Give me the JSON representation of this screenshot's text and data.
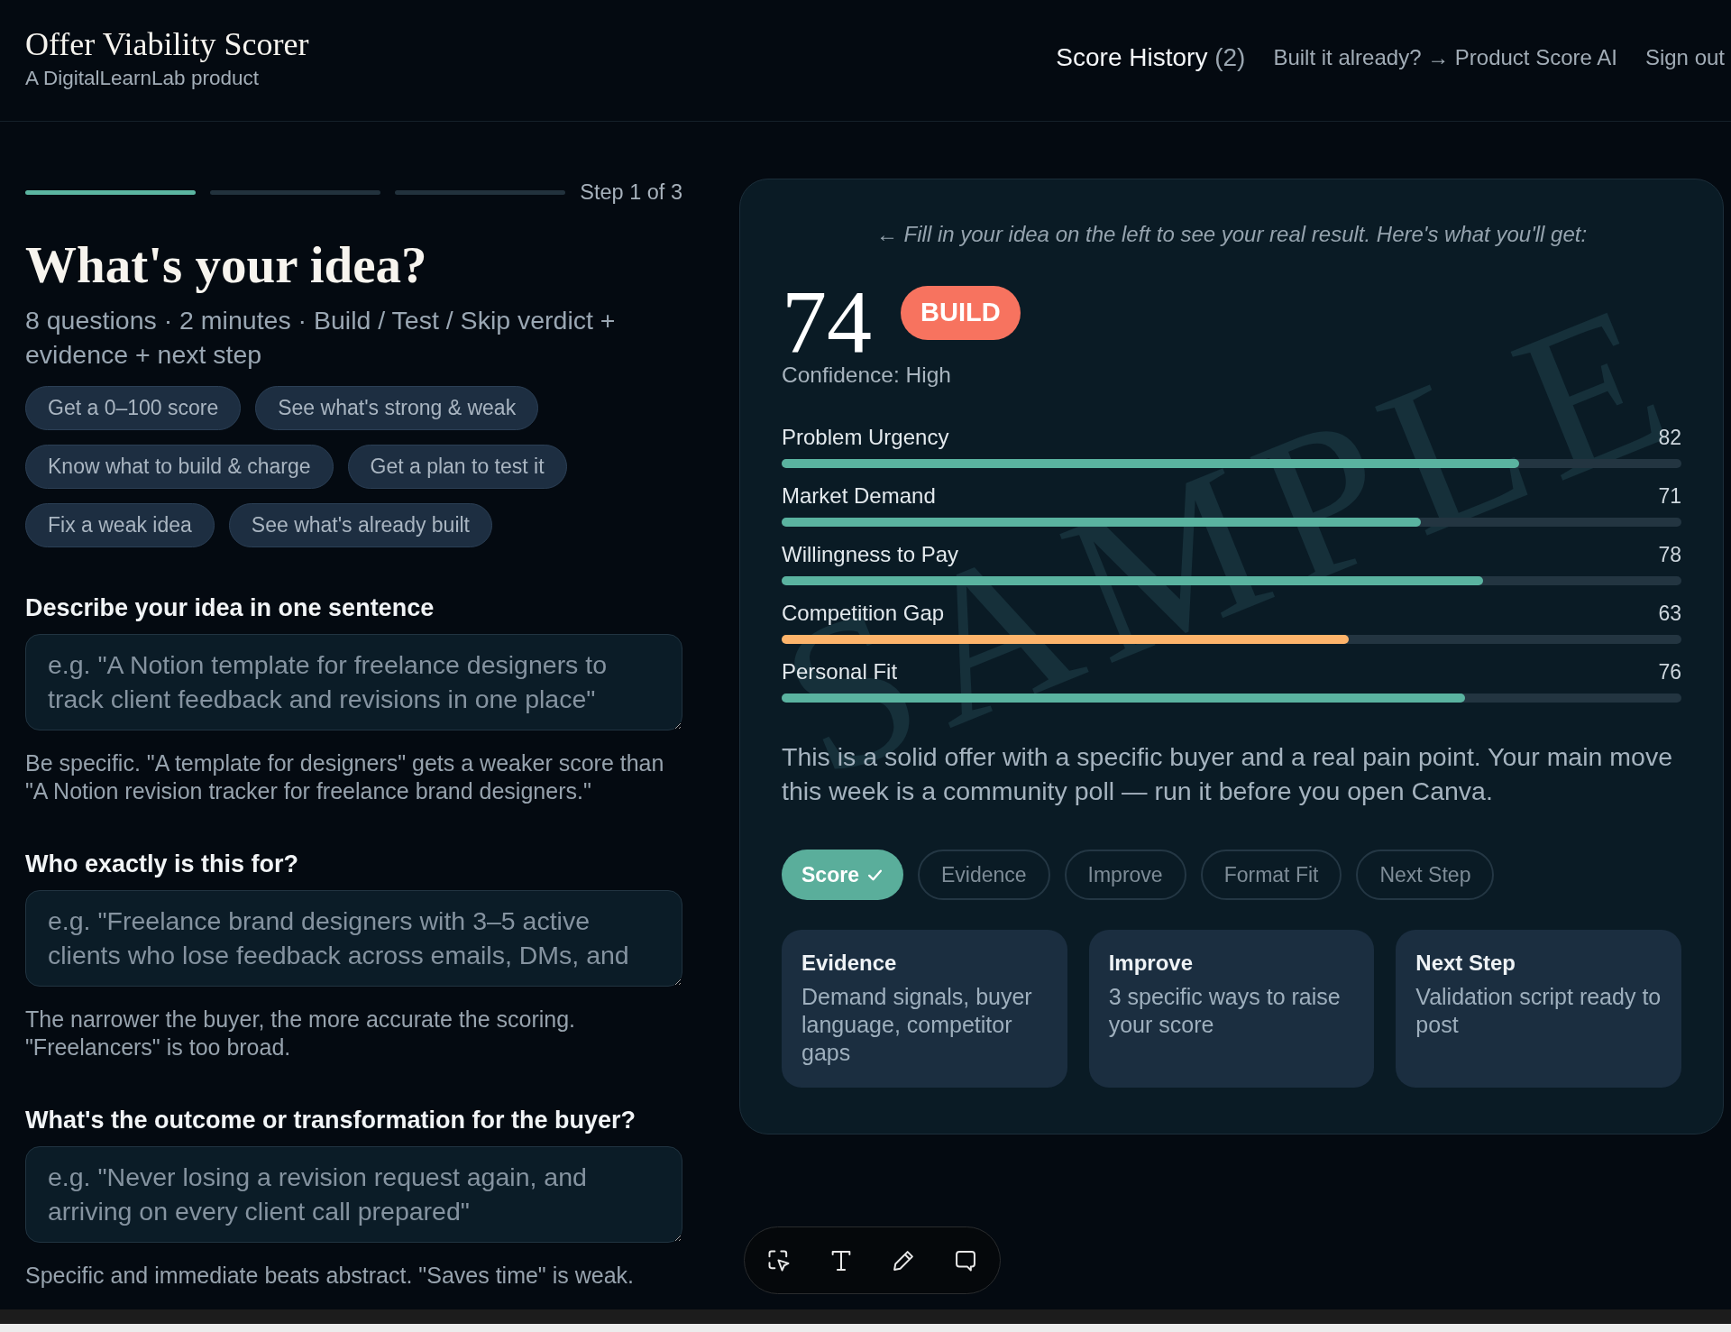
{
  "header": {
    "title": "Offer Viability Scorer",
    "subtitle": "A DigitalLearnLab product",
    "history_link": {
      "label": "Score History",
      "count": "(2)"
    },
    "links": [
      "Built it already? → Product Score AI",
      "Sign out"
    ]
  },
  "progress": {
    "segments": [
      {
        "active": true
      },
      {
        "active": false
      },
      {
        "active": false
      }
    ],
    "label": "Step 1 of 3"
  },
  "intro": {
    "heading": "What's your idea?",
    "description": "8 questions · 2 minutes · Build / Test / Skip verdict + evidence + next step",
    "chips": [
      "Get a 0–100 score",
      "See what's strong & weak",
      "Know what to build & charge",
      "Get a plan to test it",
      "Fix a weak idea",
      "See what's already built"
    ]
  },
  "fields": [
    {
      "label": "Describe your idea in one sentence",
      "placeholder": "e.g. \"A Notion template for freelance designers to track client feedback and revisions in one place\"",
      "hint": "Be specific. \"A template for designers\" gets a weaker score than \"A Notion revision tracker for freelance brand designers.\""
    },
    {
      "label": "Who exactly is this for?",
      "placeholder": "e.g. \"Freelance brand designers with 3–5 active clients who lose feedback across emails, DMs, and",
      "hint": "The narrower the buyer, the more accurate the scoring. \"Freelancers\" is too broad."
    },
    {
      "label": "What's the outcome or transformation for the buyer?",
      "placeholder": "e.g. \"Never losing a revision request again, and arriving on every client call prepared\"",
      "hint": "Specific and immediate beats abstract. \"Saves time\" is weak."
    }
  ],
  "preview": {
    "note": "← Fill in your idea on the left to see your real result. Here's what you'll get:",
    "watermark": "SAMPLE",
    "score": "74",
    "verdict": "BUILD",
    "confidence": "Confidence: High",
    "metrics": [
      {
        "name": "Problem Urgency",
        "value": "82",
        "level": 0.82,
        "color": "#5ab3a0"
      },
      {
        "name": "Market Demand",
        "value": "71",
        "level": 0.71,
        "color": "#5ab3a0"
      },
      {
        "name": "Willingness to Pay",
        "value": "78",
        "level": 0.78,
        "color": "#5ab3a0"
      },
      {
        "name": "Competition Gap",
        "value": "63",
        "level": 0.63,
        "color": "#fdb46b"
      },
      {
        "name": "Personal Fit",
        "value": "76",
        "level": 0.76,
        "color": "#5ab3a0"
      }
    ],
    "summary": "This is a solid offer with a specific buyer and a real pain point. Your main move this week is a community poll — run it before you open Canva.",
    "tabs": [
      {
        "label": "Score",
        "selected": true,
        "completed": true
      },
      {
        "label": "Evidence",
        "selected": false,
        "completed": false
      },
      {
        "label": "Improve",
        "selected": false,
        "completed": false
      },
      {
        "label": "Format Fit",
        "selected": false,
        "completed": false
      },
      {
        "label": "Next Step",
        "selected": false,
        "completed": false
      }
    ],
    "cards": [
      {
        "title": "Evidence",
        "description": "Demand signals, buyer language, competitor gaps"
      },
      {
        "title": "Improve",
        "description": "3 specific ways to raise your score"
      },
      {
        "title": "Next Step",
        "description": "Validation script ready to post"
      }
    ]
  }
}
